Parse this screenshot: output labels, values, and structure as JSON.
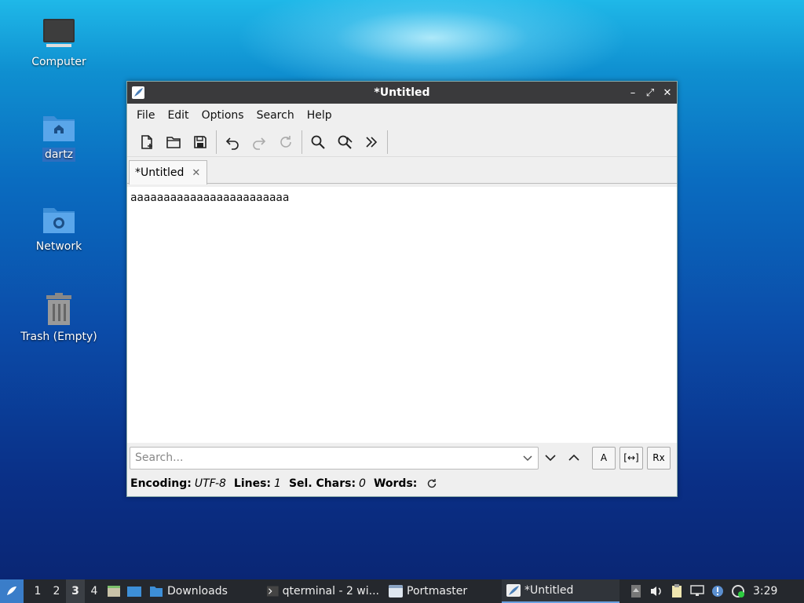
{
  "desktop": {
    "icons": [
      {
        "label": "Computer"
      },
      {
        "label": "dartz"
      },
      {
        "label": "Network"
      },
      {
        "label": "Trash (Empty)"
      }
    ]
  },
  "window": {
    "title": "*Untitled",
    "controls": {
      "minimize": "–",
      "maximize": "⤢",
      "close": "✕"
    },
    "menu": [
      "File",
      "Edit",
      "Options",
      "Search",
      "Help"
    ],
    "toolbar": [
      "new-file-icon",
      "open-folder-icon",
      "save-icon",
      "undo-icon",
      "redo-icon",
      "reload-icon",
      "find-icon",
      "find-replace-icon",
      "more-icon"
    ],
    "tab": {
      "label": "*Untitled",
      "close": "✕"
    },
    "editor_text": "aaaaaaaaaaaaaaaaaaaaaaaa",
    "search": {
      "placeholder": "Search...",
      "buttons": {
        "match_case": "A",
        "whole_word": "[↔]",
        "regex": "Rx"
      }
    },
    "status": {
      "encoding_label": "Encoding:",
      "encoding_value": "UTF-8",
      "lines_label": "Lines:",
      "lines_value": "1",
      "sel_label": "Sel. Chars:",
      "sel_value": "0",
      "words_label": "Words:"
    }
  },
  "taskbar": {
    "workspaces": [
      "1",
      "2",
      "3",
      "4"
    ],
    "active_workspace": "3",
    "tasks": [
      {
        "label": "Downloads"
      },
      {
        "label": "qterminal - 2 wi..."
      },
      {
        "label": "Portmaster"
      },
      {
        "label": "*Untitled"
      }
    ],
    "clock": "3:29"
  },
  "colors": {
    "accent": "#3a7dc9",
    "titlebar": "#3a3a3c",
    "taskbar": "#25282d"
  }
}
